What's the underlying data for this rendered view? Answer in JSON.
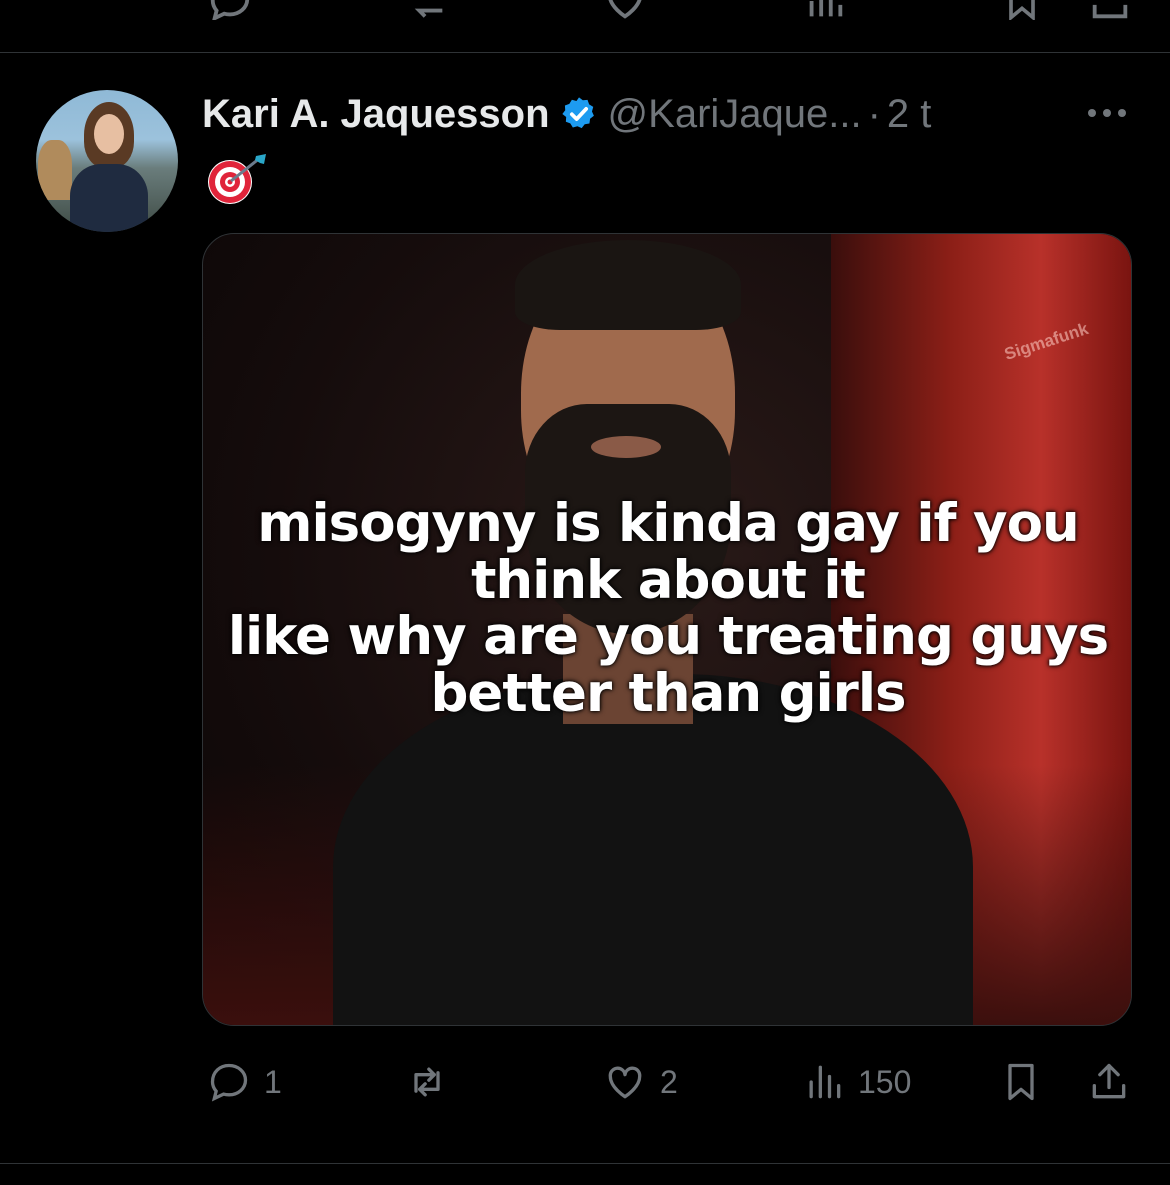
{
  "tweet": {
    "author_name": "Kari A. Jaquesson",
    "handle": "@KariJaque...",
    "separator": "·",
    "time": "2 t",
    "text_emoji": "🎯",
    "image_text_lines": [
      "misogyny is kinda gay if you",
      "think about it",
      "like why are you treating guys",
      "better than girls"
    ],
    "watermark": "Sigmafunk",
    "actions": {
      "replies": "1",
      "retweets": "",
      "likes": "2",
      "views": "150"
    }
  },
  "icons": {
    "verified": "verified-badge-icon",
    "more": "more-options-icon",
    "reply": "reply-icon",
    "retweet": "retweet-icon",
    "like": "heart-icon",
    "views": "views-icon",
    "bookmark": "bookmark-icon",
    "share": "share-icon"
  },
  "colors": {
    "background": "#000000",
    "text": "#e7e9ea",
    "secondary": "#71767b",
    "verified": "#1d9bf0",
    "divider": "#2f3336"
  }
}
